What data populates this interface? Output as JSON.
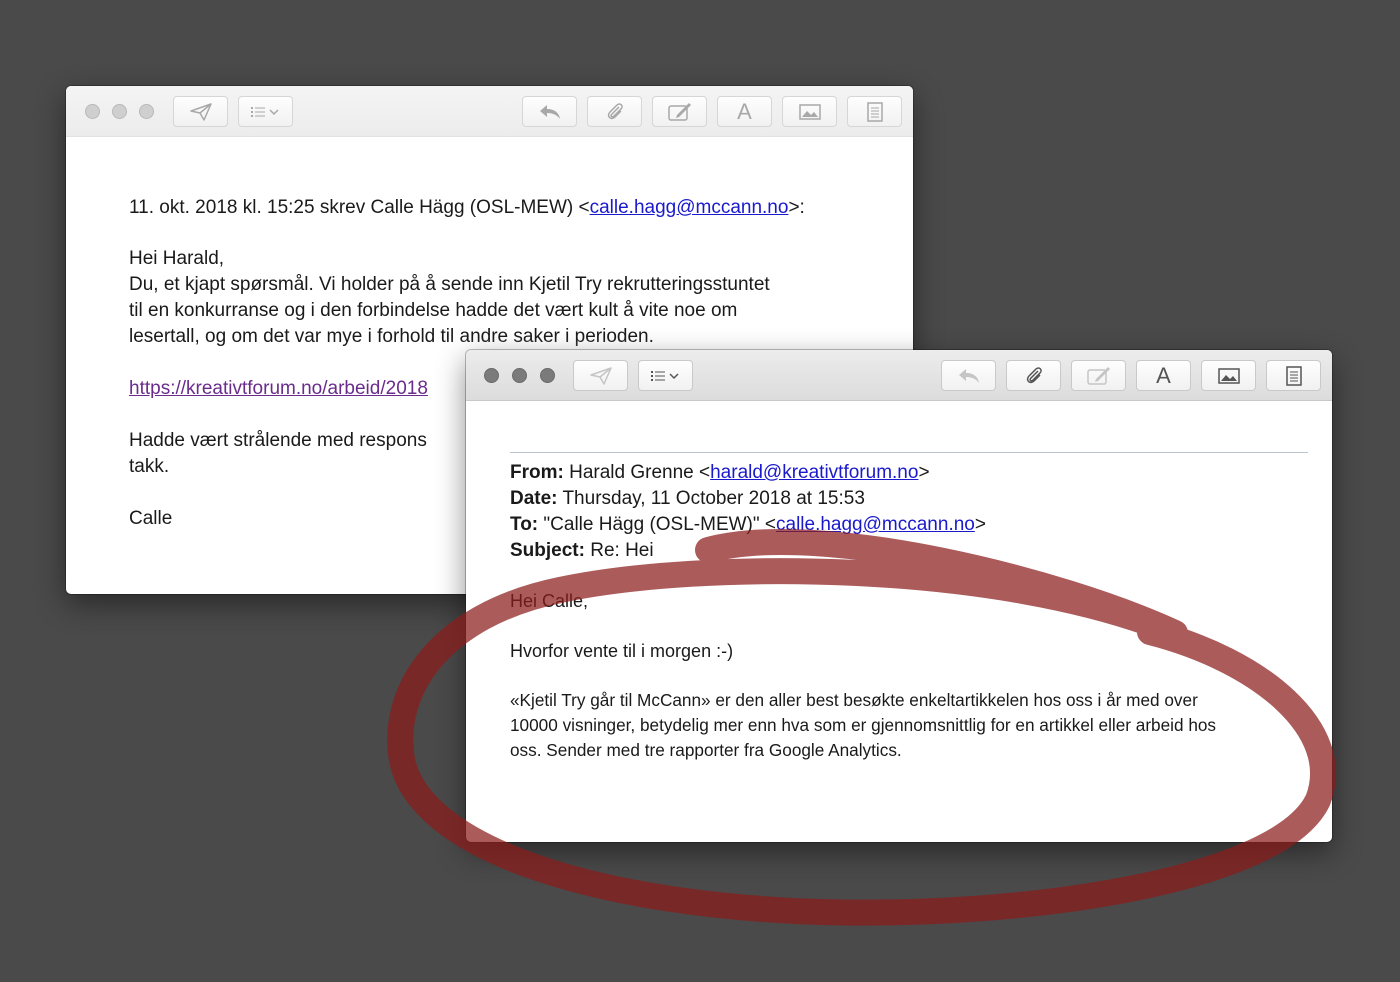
{
  "back_window": {
    "quote_header_prefix": "11. okt. 2018 kl. 15:25 skrev Calle Hägg (OSL-MEW) <",
    "quote_header_email": "calle.hagg@mccann.no",
    "quote_header_suffix": ">:",
    "greeting": "Hei Harald,",
    "body_lines": [
      "Du, et kjapt spørsmål. Vi holder på å sende inn Kjetil Try rekrutteringsstuntet",
      "til en konkurranse og i den forbindelse hadde det vært kult å vite noe om",
      "lesertall, og om det var mye i forhold til andre saker i perioden."
    ],
    "link": "https://kreativtforum.no/arbeid/2018",
    "closing_line1": "Hadde vært strålende med respons",
    "closing_line2": "takk.",
    "signature": "Calle"
  },
  "front_window": {
    "from_label": "From:",
    "from_name": " Harald Grenne <",
    "from_email": "harald@kreativtforum.no",
    "from_suffix": ">",
    "date_label": "Date:",
    "date_value": " Thursday, 11 October 2018 at 15:53",
    "to_label": "To:",
    "to_name": " \"Calle Hägg (OSL-MEW)\" <",
    "to_email": "calle.hagg@mccann.no",
    "to_suffix": ">",
    "subject_label": "Subject:",
    "subject_value": " Re: Hei",
    "greeting": "Hei Calle,",
    "line1": "Hvorfor vente til i morgen :-)",
    "paragraph_lines": [
      "«Kjetil Try går til McCann» er den aller best besøkte enkeltartikkelen hos oss i år med over",
      "10000 visninger, betydelig mer enn hva som er gjennomsnittlig for en artikkel eller arbeid hos",
      "oss. Sender med tre rapporter fra Google Analytics."
    ]
  },
  "toolbar_icons": [
    "send-icon",
    "format-list-icon",
    "reply-icon",
    "attachment-icon",
    "markup-icon",
    "font-icon",
    "photo-icon",
    "template-icon"
  ],
  "font_button_glyph": "A",
  "annotation_color": "#8c1c1c"
}
